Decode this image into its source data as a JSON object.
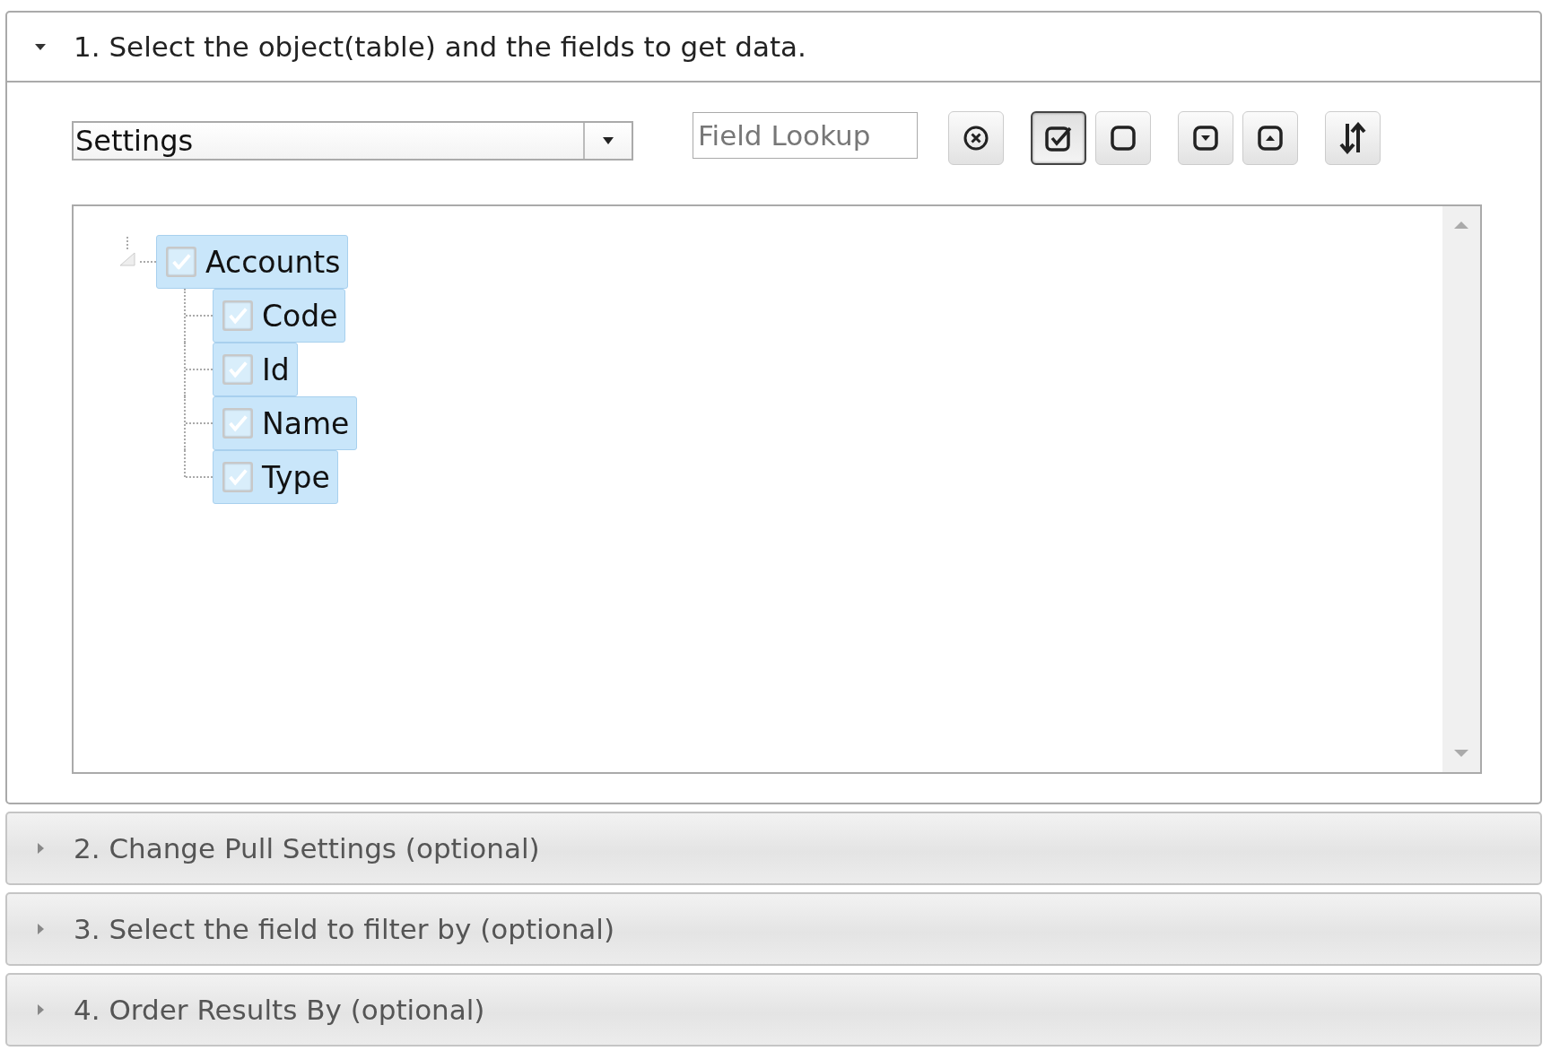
{
  "sections": [
    {
      "title": "1. Select the object(table) and the fields to get data.",
      "expanded": true
    },
    {
      "title": "2. Change Pull Settings (optional)",
      "expanded": false
    },
    {
      "title": "3. Select the field to filter by (optional)",
      "expanded": false
    },
    {
      "title": "4. Order Results By (optional)",
      "expanded": false
    }
  ],
  "object_select": {
    "value": "Settings"
  },
  "field_lookup": {
    "placeholder": "Field Lookup"
  },
  "toolbar": [
    {
      "kind": "clear",
      "selected": false
    },
    {
      "kind": "check-all",
      "selected": true
    },
    {
      "kind": "uncheck-all",
      "selected": false
    },
    {
      "kind": "expand-all",
      "selected": false
    },
    {
      "kind": "collapse-all",
      "selected": false
    },
    {
      "kind": "sort",
      "selected": false
    }
  ],
  "tree": [
    {
      "label": "Accounts",
      "checked": true,
      "selected": true,
      "expanded": true,
      "children": [
        {
          "label": "Code",
          "checked": true,
          "selected": true
        },
        {
          "label": "Id",
          "checked": true,
          "selected": true
        },
        {
          "label": "Name",
          "checked": true,
          "selected": true
        },
        {
          "label": "Type",
          "checked": true,
          "selected": true
        }
      ]
    }
  ]
}
